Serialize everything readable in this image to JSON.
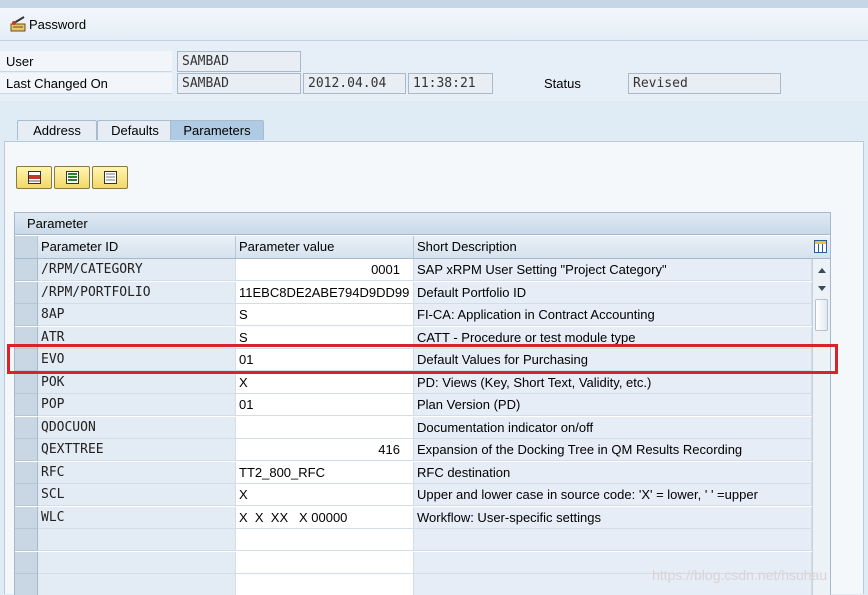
{
  "toolbar": {
    "password_label": "Password"
  },
  "header": {
    "user_label": "User",
    "user_value": "SAMBAD",
    "last_changed_label": "Last Changed On",
    "last_changed_by": "SAMBAD",
    "last_changed_date": "2012.04.04",
    "last_changed_time": "11:38:21",
    "status_label": "Status",
    "status_value": "Revised"
  },
  "tabs": [
    {
      "label": "Address",
      "active": false
    },
    {
      "label": "Defaults",
      "active": false
    },
    {
      "label": "Parameters",
      "active": true
    }
  ],
  "grid": {
    "title": "Parameter",
    "columns": [
      "Parameter ID",
      "Parameter value",
      "Short Description"
    ],
    "rows": [
      {
        "id": "/RPM/CATEGORY",
        "value": "0001",
        "desc": "SAP xRPM User Setting \"Project Category\""
      },
      {
        "id": "/RPM/PORTFOLIO",
        "value": "11EBC8DE2ABE794D9DD99",
        "desc": "Default Portfolio ID"
      },
      {
        "id": "8AP",
        "value": "S",
        "desc": "FI-CA: Application in Contract Accounting"
      },
      {
        "id": "ATR",
        "value": "S",
        "desc": "CATT - Procedure or test module type"
      },
      {
        "id": "EVO",
        "value": "01",
        "desc": "Default Values for Purchasing"
      },
      {
        "id": "POK",
        "value": "X",
        "desc": "PD: Views (Key, Short Text, Validity, etc.)"
      },
      {
        "id": "POP",
        "value": "01",
        "desc": "Plan Version (PD)"
      },
      {
        "id": "QDOCUON",
        "value": "",
        "desc": "Documentation indicator on/off"
      },
      {
        "id": "QEXTTREE",
        "value": "416",
        "desc": "Expansion of the Docking Tree in QM Results Recording"
      },
      {
        "id": "RFC",
        "value": "TT2_800_RFC",
        "desc": "RFC destination"
      },
      {
        "id": "SCL",
        "value": "X",
        "desc": "Upper and lower case in source code: 'X' = lower, ' ' =upper"
      },
      {
        "id": "WLC",
        "value": "X  X  XX   X 00000",
        "desc": "Workflow: User-specific settings"
      },
      {
        "id": "",
        "value": "",
        "desc": ""
      },
      {
        "id": "",
        "value": "",
        "desc": ""
      },
      {
        "id": "",
        "value": "",
        "desc": ""
      }
    ],
    "highlighted_row": 4
  },
  "watermark": "https://blog.csdn.net/hsuhau",
  "colors": {
    "highlight": "#d9232b",
    "tab_active": "#aecbe3",
    "background": "#dfebf5"
  }
}
